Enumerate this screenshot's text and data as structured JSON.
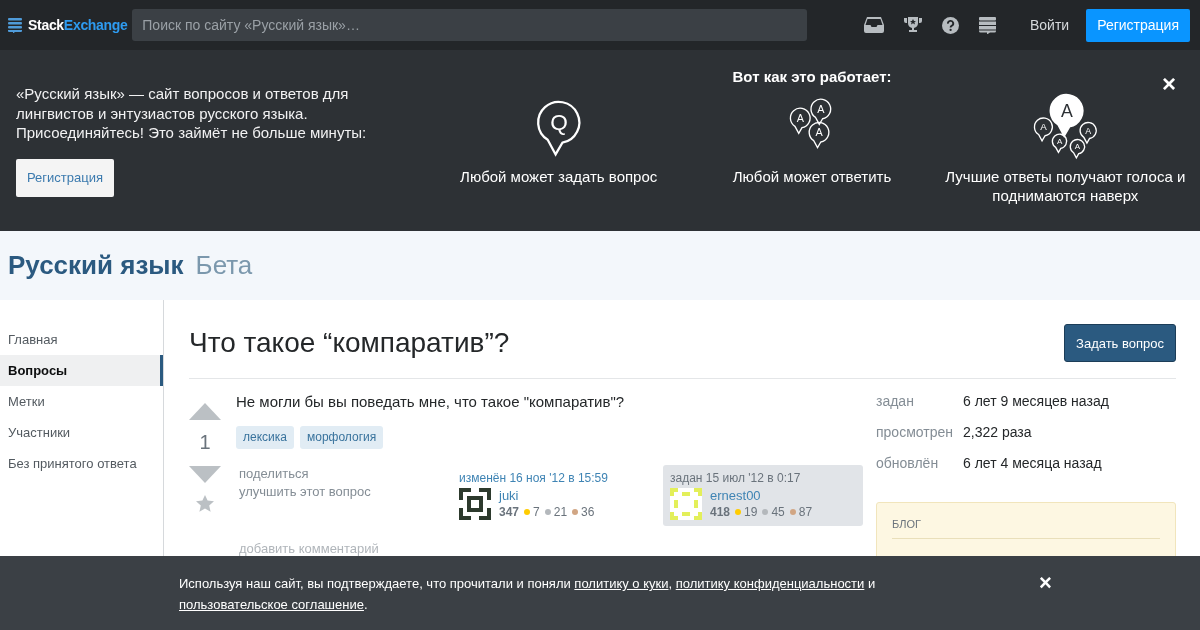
{
  "topbar": {
    "logo": {
      "part1": "Stack",
      "part2": "Exchange"
    },
    "search": {
      "placeholder": "Поиск по сайту «Русский язык»…"
    },
    "login": "Войти",
    "signup": "Регистрация"
  },
  "hero": {
    "intro": "«Русский язык» — сайт вопросов и ответов для лингвистов и энтузиастов русского языка. Присоединяйтесь! Это займёт не больше минуты:",
    "signup": "Регистрация",
    "heading": "Вот как это работает:",
    "close": "×",
    "steps": [
      {
        "kind": "ask",
        "letters": [
          "Q"
        ],
        "text": "Любой может задать вопрос"
      },
      {
        "kind": "answer",
        "letters": [
          "A",
          "A",
          "A"
        ],
        "text": "Любой может ответить"
      },
      {
        "kind": "vote",
        "letters": [
          "A",
          "A",
          "A",
          "A",
          "A"
        ],
        "text": "Лучшие ответы получают голоса и поднимаются наверх"
      }
    ]
  },
  "site": {
    "name": "Русский язык",
    "badge": "Бета"
  },
  "sidebar": {
    "items": [
      {
        "label": "Главная",
        "selected": false
      },
      {
        "label": "Вопросы",
        "selected": true
      },
      {
        "label": "Метки",
        "selected": false
      },
      {
        "label": "Участники",
        "selected": false
      },
      {
        "label": "Без принятого ответа",
        "selected": false
      }
    ]
  },
  "question": {
    "title": "Что такое “компаратив”?",
    "ask_button": "Задать вопрос",
    "score": "1",
    "body": "Не могли бы вы поведать мне, что такое \"компаратив\"?",
    "tags": [
      "лексика",
      "морфология"
    ],
    "actions": [
      "поделиться",
      "улучшить этот вопрос"
    ],
    "add_comment": "добавить комментарий",
    "cards": [
      {
        "kind": "editor",
        "action": "изменён 16 ноя '12 в 15:59",
        "user": "juki",
        "rep": "347",
        "badges": [
          {
            "color": "#ffcc01",
            "count": "7"
          },
          {
            "color": "#b4b8bc",
            "count": "21"
          },
          {
            "color": "#d1a684",
            "count": "36"
          }
        ]
      },
      {
        "kind": "owner",
        "action": "задан 15 июл '12 в 0:17",
        "user": "ernest00",
        "rep": "418",
        "badges": [
          {
            "color": "#ffcc01",
            "count": "19"
          },
          {
            "color": "#b4b8bc",
            "count": "45"
          },
          {
            "color": "#d1a684",
            "count": "87"
          }
        ]
      }
    ]
  },
  "stats": [
    {
      "label": "задан",
      "value": "6 лет 9 месяцев назад"
    },
    {
      "label": "просмотрен",
      "value": "2,322 раза"
    },
    {
      "label": "обновлён",
      "value": "6 лет 4 месяца назад"
    }
  ],
  "blog": {
    "heading": "БЛОГ"
  },
  "cookie": {
    "parts": [
      {
        "kind": "text",
        "text": "Используя наш сайт, вы подтверждаете, что прочитали и поняли "
      },
      {
        "kind": "link",
        "text": "политику о куки"
      },
      {
        "kind": "text",
        "text": ", "
      },
      {
        "kind": "link",
        "text": "политику конфиденциальности"
      },
      {
        "kind": "text",
        "text": " и "
      },
      {
        "kind": "link",
        "text": "пользовательское соглашение"
      },
      {
        "kind": "text",
        "text": "."
      }
    ],
    "close": "×"
  }
}
